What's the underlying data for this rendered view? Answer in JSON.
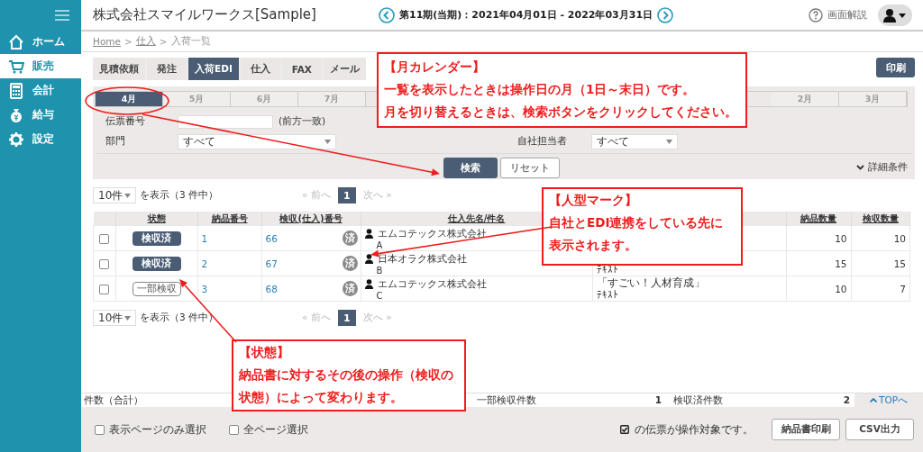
{
  "sidebar": {
    "items": [
      {
        "label": "ホーム",
        "selected": false
      },
      {
        "label": "販売",
        "selected": true
      },
      {
        "label": "会計",
        "selected": false
      },
      {
        "label": "給与",
        "selected": false
      },
      {
        "label": "設定",
        "selected": false
      }
    ]
  },
  "header": {
    "title": "株式会社スマイルワークス[Sample]",
    "period": "第11期(当期)：2021年04月01日 - 2022年03月31日",
    "help": "画面解説"
  },
  "breadcrumb": {
    "separator": ">",
    "items": [
      {
        "label": "Home",
        "link": true
      },
      {
        "label": "仕入",
        "link": true
      },
      {
        "label": "入荷一覧",
        "link": false
      }
    ]
  },
  "tabs": [
    {
      "label": "見積依頼",
      "selected": false
    },
    {
      "label": "発注",
      "selected": false
    },
    {
      "label": "入荷EDI",
      "selected": true
    },
    {
      "label": "仕入",
      "selected": false
    },
    {
      "label": "FAX",
      "selected": false
    },
    {
      "label": "メール",
      "selected": false
    }
  ],
  "print_button": "印刷",
  "months": [
    {
      "label": "4月",
      "selected": true
    },
    {
      "label": "5月",
      "selected": false
    },
    {
      "label": "6月",
      "selected": false
    },
    {
      "label": "7月",
      "selected": false
    },
    {
      "label": "2月",
      "selected": false
    },
    {
      "label": "3月",
      "selected": false
    }
  ],
  "filters": {
    "slip_number": {
      "label": "伝票番号",
      "note": "(前方一致)"
    },
    "department": {
      "label": "部門",
      "value": "すべて"
    },
    "staff": {
      "label": "自社担当者",
      "value": "すべて"
    }
  },
  "search_button": "検索",
  "reset_button": "リセット",
  "detail_toggle": "詳細条件",
  "pagination": [
    {
      "per_page": "10件",
      "summary": "を表示（3 件中）",
      "prev": "« 前へ",
      "prev_disabled": true,
      "page": "1",
      "next": "次へ »",
      "next_disabled": true
    },
    {
      "per_page": "10件",
      "summary": "を表示（3 件中）",
      "prev": "« 前へ",
      "prev_disabled": true,
      "page": "1",
      "next": "次へ »",
      "next_disabled": true
    }
  ],
  "table": {
    "columns": [
      "状態",
      "納品番号",
      "検収(仕入)番号",
      "仕入先名/件名",
      "納品数量",
      "検収数量"
    ],
    "rows": [
      {
        "checked": false,
        "status": {
          "kind": "done",
          "label": "検収済"
        },
        "delivery_no": "1",
        "receipt_no": "66",
        "mark": "済",
        "edi": true,
        "supplier": "エムコテックス株式会社",
        "supplier_sub": "A",
        "qty": "10",
        "received": "10"
      },
      {
        "checked": false,
        "status": {
          "kind": "done",
          "label": "検収済"
        },
        "delivery_no": "2",
        "receipt_no": "67",
        "mark": "済",
        "edi": true,
        "supplier": "日本オラク株式会社",
        "supplier_sub": "B",
        "subject_note": "ﾃｷｽﾄ",
        "qty": "15",
        "received": "15"
      },
      {
        "checked": false,
        "status": {
          "kind": "partial",
          "label": "一部検収"
        },
        "delivery_no": "3",
        "receipt_no": "68",
        "mark": "済",
        "edi": true,
        "supplier": "エムコテックス株式会社",
        "supplier_sub": "C",
        "subject": "「すごい！人材育成」",
        "subject_note": "ﾃｷｽﾄ",
        "qty": "10",
        "received": "7"
      }
    ]
  },
  "totals": [
    {
      "label": "件数（合計）"
    },
    {
      "label": "一部検収件数",
      "value": "1"
    },
    {
      "label": "検収済件数",
      "value": "2"
    }
  ],
  "top_link": "TOPへ",
  "select_options": [
    {
      "label": "表示ページのみ選択",
      "checked": false
    },
    {
      "label": "全ページ選択",
      "checked": false
    }
  ],
  "target_note": "の伝票が操作対象です。",
  "actions": [
    "納品書印刷",
    "CSV出力"
  ],
  "annotations": [
    {
      "title": "【月カレンダー】",
      "lines": [
        "一覧を表示したときは操作日の月（1日～末日）です。",
        "月を切り替えるときは、検索ボタンをクリックしてください。"
      ]
    },
    {
      "title": "【人型マーク】",
      "lines": [
        "自社とEDI連携をしている先に",
        "表示されます。"
      ]
    },
    {
      "title": "【状態】",
      "lines": [
        "納品書に対するその後の操作（検収の",
        "状態）によって変わります。"
      ]
    }
  ]
}
